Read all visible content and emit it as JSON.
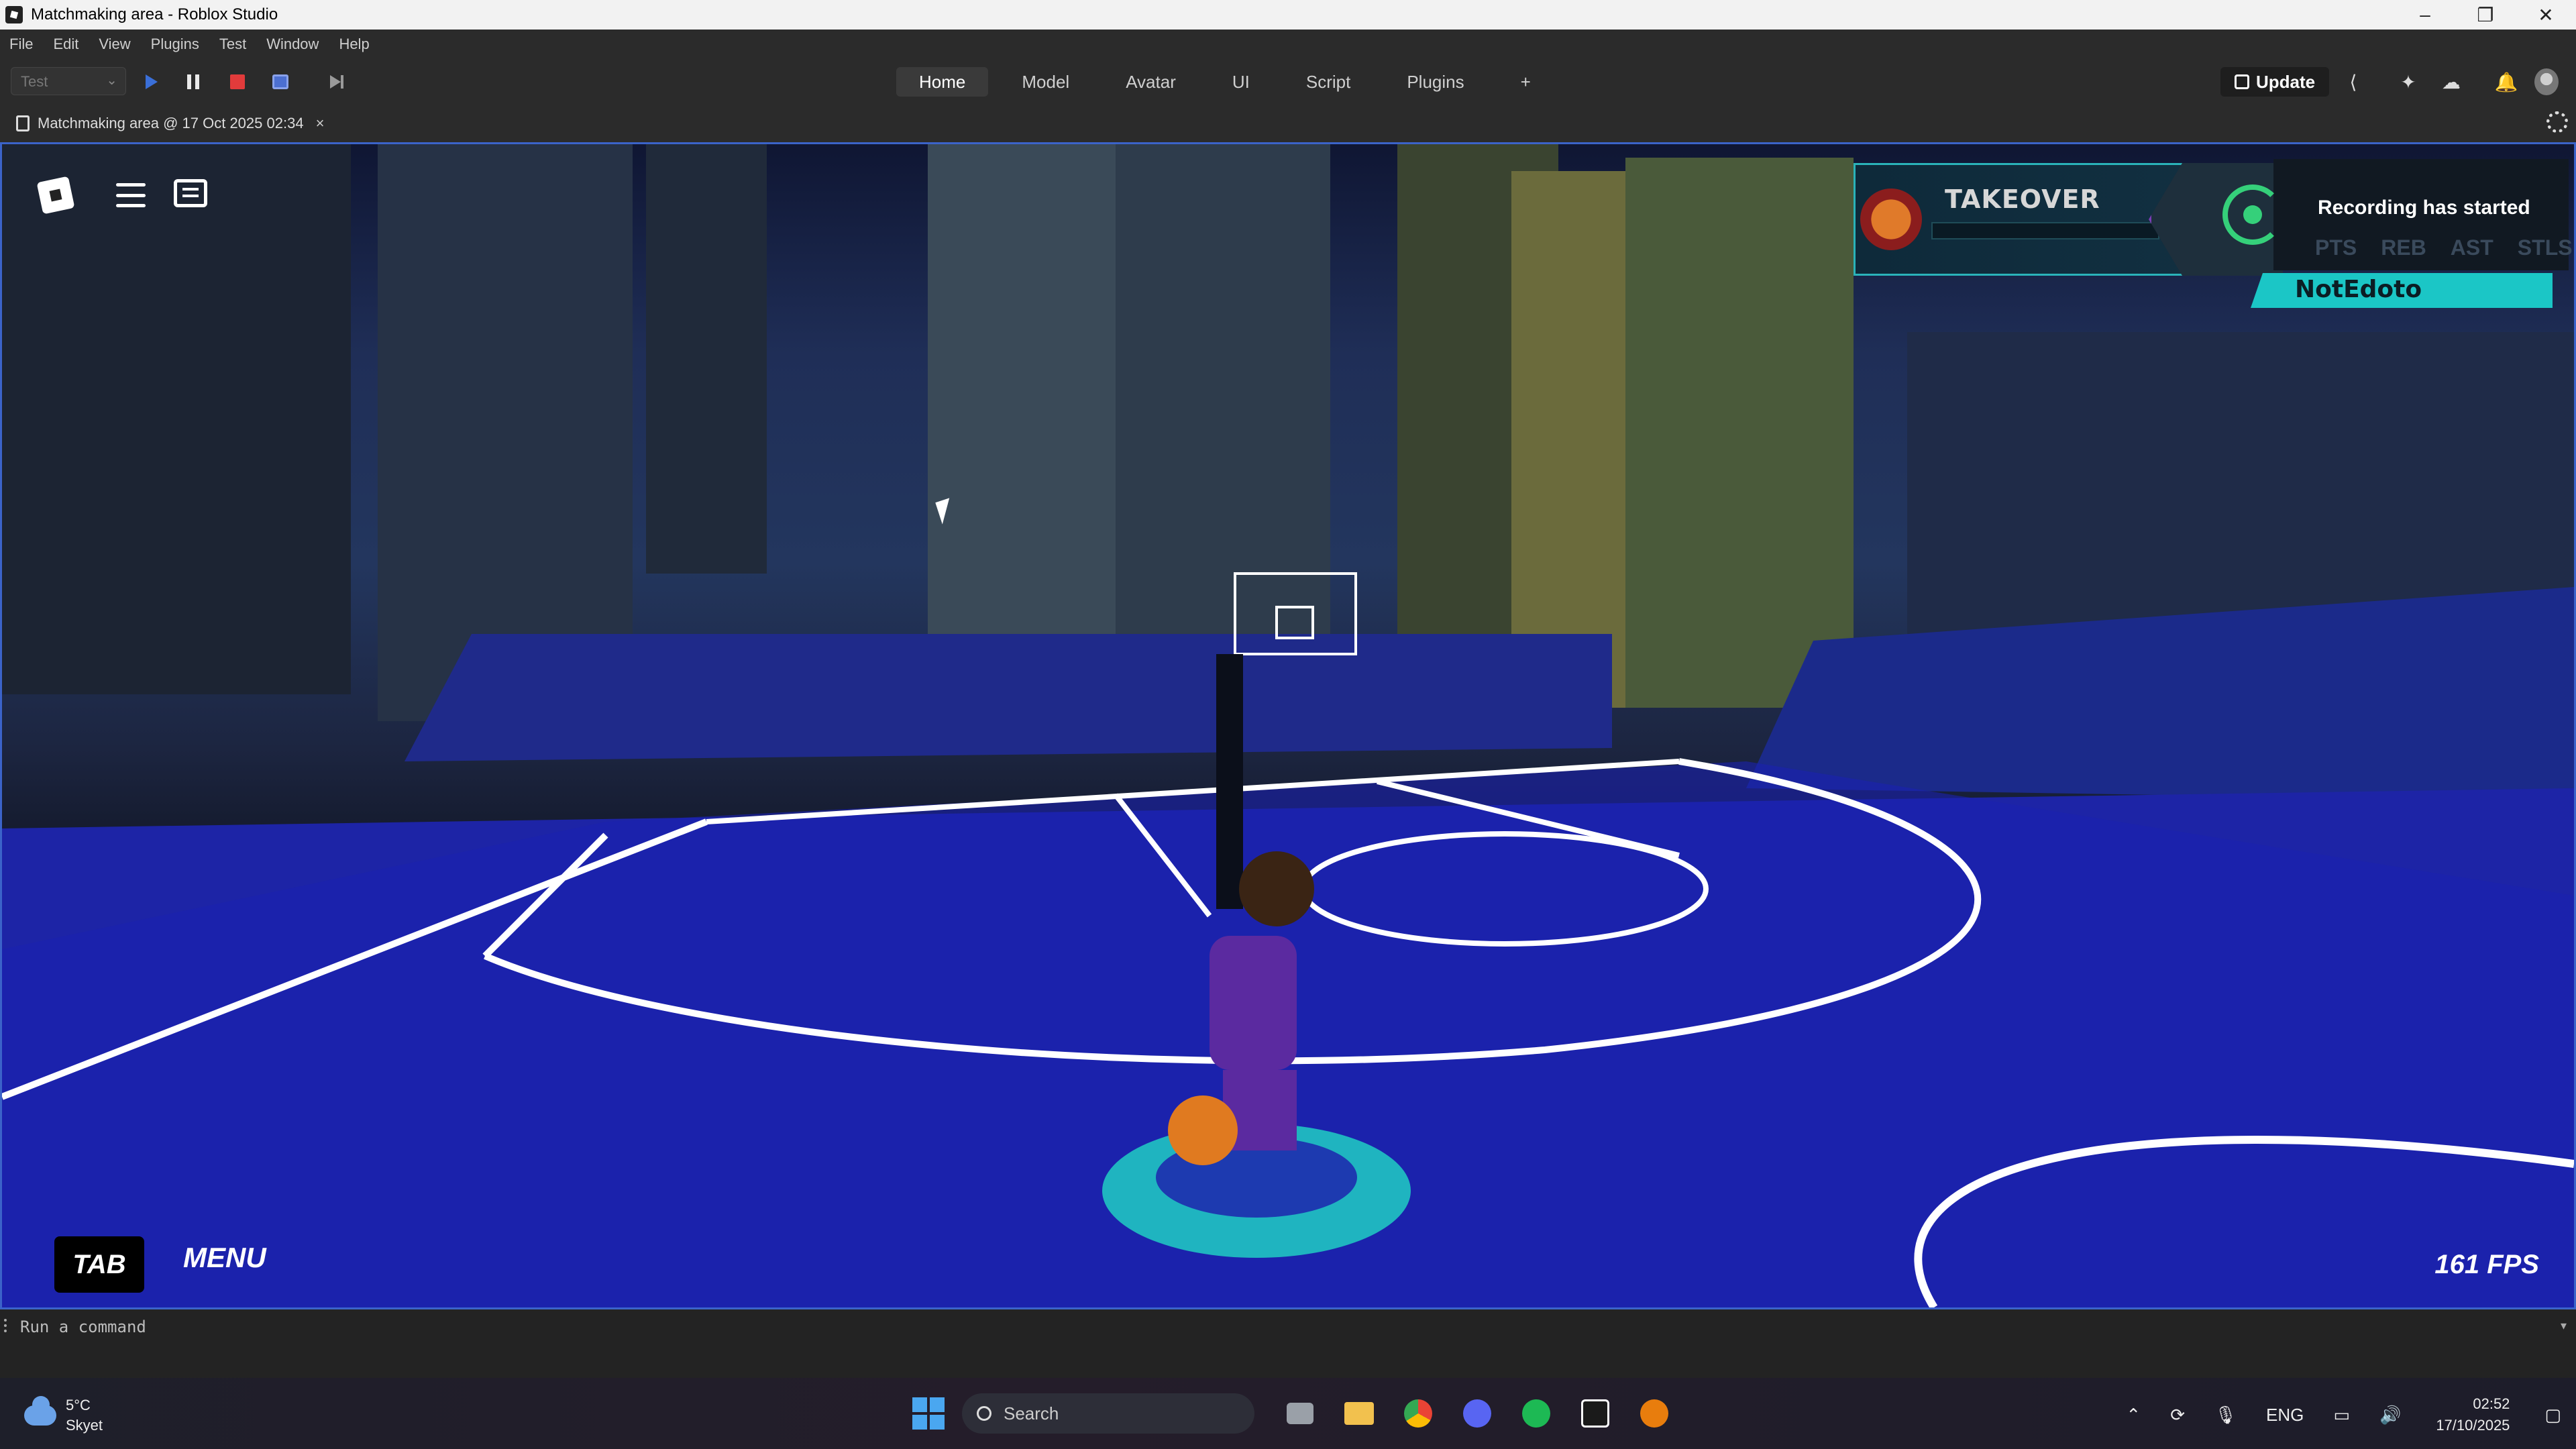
{
  "titlebar": {
    "title": "Matchmaking area - Roblox Studio",
    "minimize": "–",
    "maximize": "❐",
    "close": "✕"
  },
  "menu": [
    "File",
    "Edit",
    "View",
    "Plugins",
    "Test",
    "Window",
    "Help"
  ],
  "toolbar": {
    "mode": "Test",
    "tabs": [
      "Home",
      "Model",
      "Avatar",
      "UI",
      "Script",
      "Plugins",
      "+"
    ],
    "active_tab": "Home",
    "update_label": "Update"
  },
  "document_tab": {
    "label": "Matchmaking area @ 17 Oct 2025 02:34",
    "close": "×"
  },
  "game_hud": {
    "takeover_title": "TAKEOVER",
    "recording": "Recording has started",
    "stats": [
      "PTS",
      "REB",
      "AST",
      "STLS"
    ],
    "player_name": "NotEdoto",
    "tab_button": "TAB",
    "menu_button": "MENU",
    "fps": "161 FPS"
  },
  "command_bar": {
    "placeholder": "Run a command"
  },
  "taskbar": {
    "weather_temp": "5°C",
    "weather_desc": "Skyet",
    "search_label": "Search",
    "lang": "ENG",
    "time": "02:52",
    "date": "17/10/2025"
  },
  "colors": {
    "accent": "#3b63c9",
    "hud_cyan": "#1bc6c6",
    "court": "#1d24a6"
  }
}
